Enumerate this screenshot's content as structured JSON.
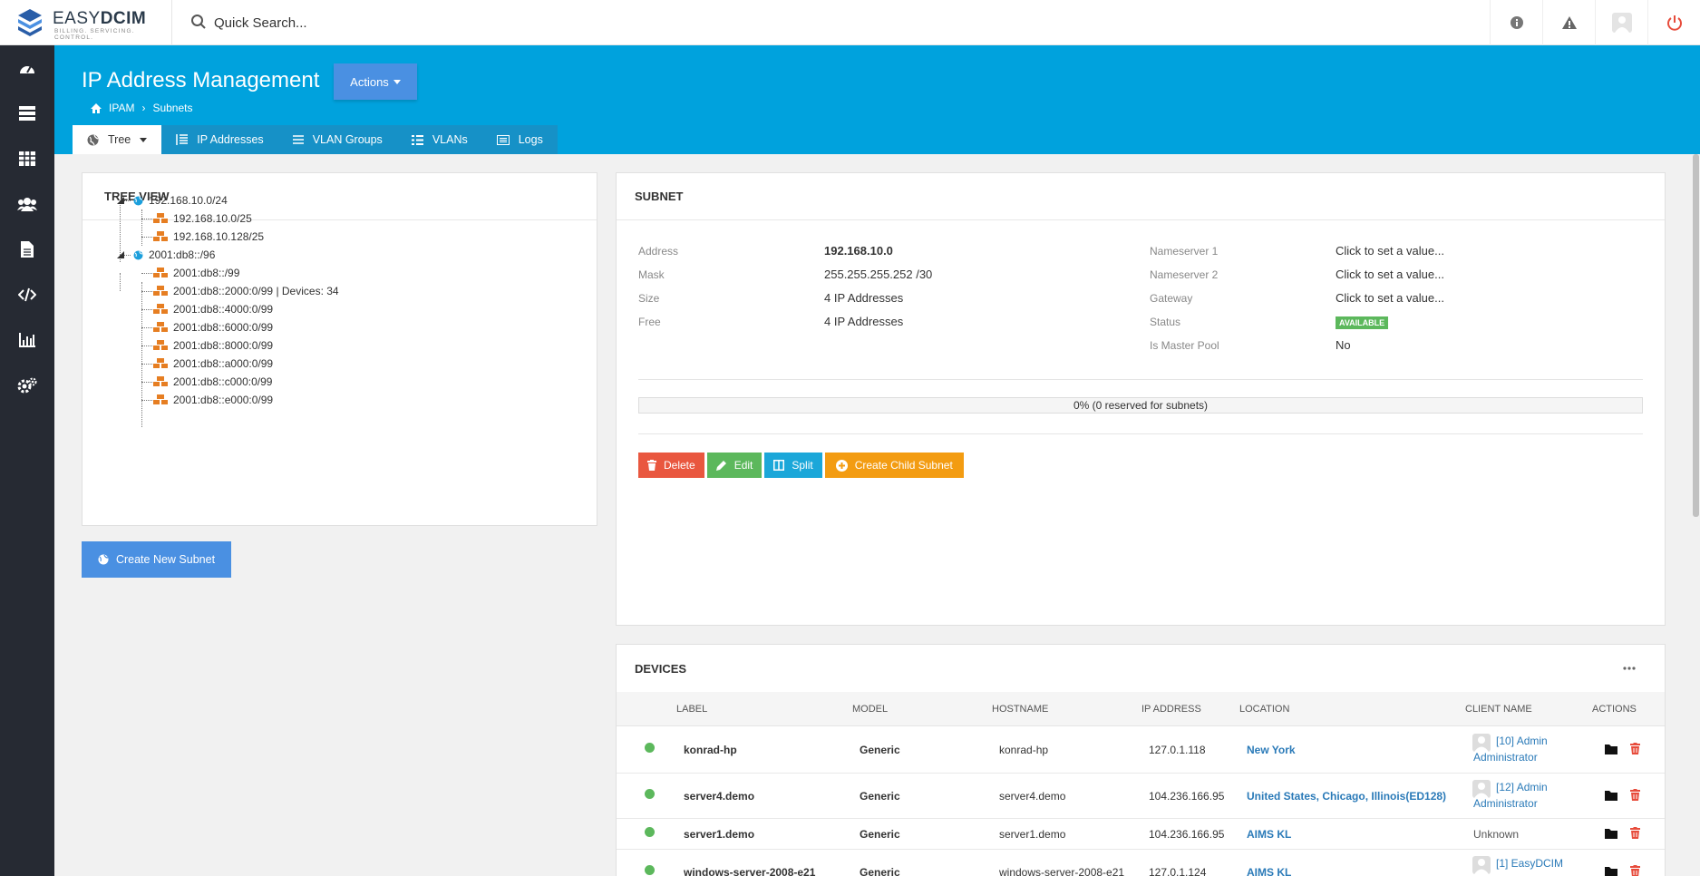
{
  "app": {
    "logo_text_light": "EASY",
    "logo_text_bold": "DCIM",
    "logo_tagline": "BILLING. SERVICING. CONTROL."
  },
  "search": {
    "placeholder": "Quick Search..."
  },
  "topbar_icons": [
    "info-icon",
    "warning-icon",
    "user-avatar-icon",
    "power-icon"
  ],
  "sidebar_icons": [
    "dashboard-icon",
    "servers-icon",
    "table-icon",
    "users-icon",
    "document-icon",
    "code-icon",
    "chart-icon",
    "settings-icon"
  ],
  "header": {
    "title": "IP Address Management",
    "actions_label": "Actions",
    "breadcrumb": [
      "IPAM",
      "Subnets"
    ]
  },
  "tabs": [
    {
      "label": "Tree",
      "icon": "globe-icon",
      "active": true
    },
    {
      "label": "IP Addresses",
      "icon": "list-icon"
    },
    {
      "label": "VLAN Groups",
      "icon": "bars-icon"
    },
    {
      "label": "VLANs",
      "icon": "list-alt-icon"
    },
    {
      "label": "Logs",
      "icon": "logs-icon"
    }
  ],
  "tree_view": {
    "title": "TREE VIEW",
    "nodes": [
      {
        "label": "192.168.10.0/24",
        "type": "root"
      },
      {
        "label": "192.168.10.0/25",
        "type": "child"
      },
      {
        "label": "192.168.10.128/25",
        "type": "child"
      },
      {
        "label": "2001:db8::/96",
        "type": "root"
      },
      {
        "label": "2001:db8::/99",
        "type": "child"
      },
      {
        "label": "2001:db8::2000:0/99 | Devices: 34",
        "type": "child"
      },
      {
        "label": "2001:db8::4000:0/99",
        "type": "child"
      },
      {
        "label": "2001:db8::6000:0/99",
        "type": "child"
      },
      {
        "label": "2001:db8::8000:0/99",
        "type": "child"
      },
      {
        "label": "2001:db8::a000:0/99",
        "type": "child"
      },
      {
        "label": "2001:db8::c000:0/99",
        "type": "child"
      },
      {
        "label": "2001:db8::e000:0/99",
        "type": "child"
      }
    ],
    "create_button": "Create New Subnet"
  },
  "subnet": {
    "title": "SUBNET",
    "left": [
      {
        "label": "Address",
        "value": "192.168.10.0"
      },
      {
        "label": "Mask",
        "value": "255.255.255.252 /30"
      },
      {
        "label": "Size",
        "value": "4 IP Addresses"
      },
      {
        "label": "Free",
        "value": "4 IP Addresses"
      }
    ],
    "right": [
      {
        "label": "Nameserver 1",
        "value": "Click to set a value..."
      },
      {
        "label": "Nameserver 2",
        "value": "Click to set a value..."
      },
      {
        "label": "Gateway",
        "value": "Click to set a value..."
      },
      {
        "label": "Status",
        "value": "AVAILABLE"
      },
      {
        "label": "Is Master Pool",
        "value": "No"
      }
    ],
    "progress_text": "0% (0 reserved for subnets)",
    "progress_fraction": 0,
    "buttons": {
      "delete": "Delete",
      "edit": "Edit",
      "split": "Split",
      "create_child": "Create Child Subnet"
    }
  },
  "devices": {
    "title": "DEVICES",
    "menu_icon": "more-icon",
    "columns": [
      "LABEL",
      "MODEL",
      "HOSTNAME",
      "IP ADDRESS",
      "LOCATION",
      "CLIENT NAME",
      "ACTIONS"
    ],
    "rows": [
      {
        "label": "konrad-hp",
        "model": "Generic",
        "hostname": "konrad-hp",
        "ip": "127.0.1.118",
        "location": "New York",
        "client_line1": "[10] Admin",
        "client_line2": "Administrator"
      },
      {
        "label": "server4.demo",
        "model": "Generic",
        "hostname": "server4.demo",
        "ip": "104.236.166.95",
        "location": "United States, Chicago, Illinois(ED128)",
        "client_line1": "[12] Admin",
        "client_line2": "Administrator"
      },
      {
        "label": "server1.demo",
        "model": "Generic",
        "hostname": "server1.demo",
        "ip": "104.236.166.95",
        "location": "AIMS KL",
        "client_line1": "Unknown",
        "client_line2": ""
      },
      {
        "label": "windows-server-2008-e21",
        "model": "Generic",
        "hostname": "windows-server-2008-e21",
        "ip": "127.0.1.124",
        "location": "AIMS KL",
        "client_line1": "[1] EasyDCIM",
        "client_line2": ""
      }
    ]
  },
  "colors": {
    "header": "#00a2dd",
    "sidebar": "#262a33",
    "primary_button": "#4a90e2",
    "delete": "#e9573f",
    "edit": "#5cb85c",
    "split": "#1ba7d9",
    "create_child": "#f39c12",
    "status_ok": "#5cb85c"
  }
}
